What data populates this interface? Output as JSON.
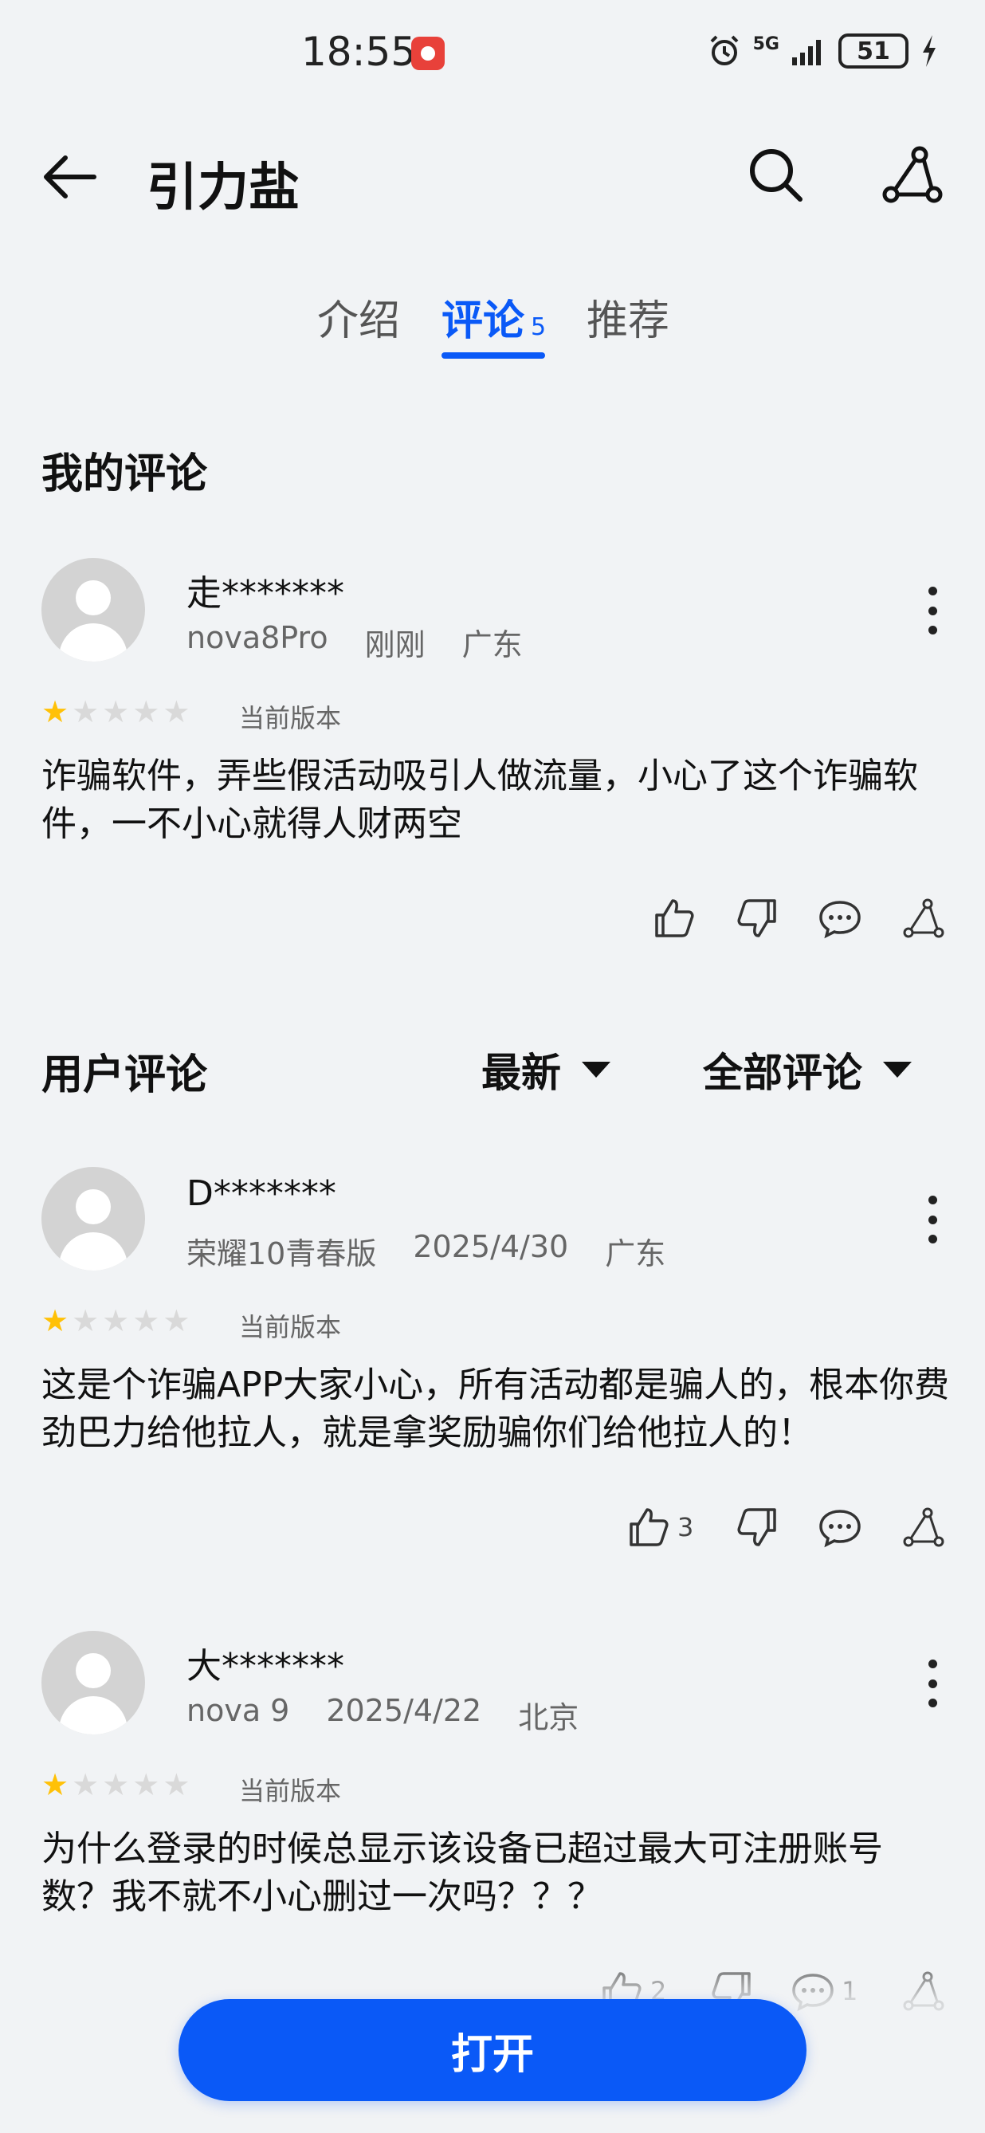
{
  "status_bar": {
    "time": "18:55",
    "network": "5G",
    "battery": "51",
    "icons": [
      "alarm-icon",
      "signal-icon",
      "charging-icon"
    ]
  },
  "header": {
    "title": "引力盐",
    "icons": [
      "back-arrow-icon",
      "search-icon",
      "share-icon"
    ]
  },
  "tabs": [
    {
      "label": "介绍"
    },
    {
      "label": "评论",
      "count": "5",
      "active": true
    },
    {
      "label": "推荐"
    }
  ],
  "my_reviews": {
    "section_title": "我的评论",
    "review": {
      "user": "走*******",
      "device": "nova8Pro",
      "time": "刚刚",
      "location": "广东",
      "rating": 1,
      "version_label": "当前版本",
      "text": "诈骗软件，弄些假活动吸引人做流量，小心了这个诈骗软件，一不小心就得人财两空"
    }
  },
  "user_reviews": {
    "section_title": "用户评论",
    "sort_latest": "最新",
    "filter_all": "全部评论",
    "items": [
      {
        "user": "D*******",
        "device": "荣耀10青春版",
        "time": "2025/4/30",
        "location": "广东",
        "rating": 1,
        "version_label": "当前版本",
        "text": "这是个诈骗APP大家小心，所有活动都是骗人的，根本你费劲巴力给他拉人，就是拿奖励骗你们给他拉人的！",
        "likes": "3",
        "comments": ""
      },
      {
        "user": "大*******",
        "device": "nova 9",
        "time": "2025/4/22",
        "location": "北京",
        "rating": 1,
        "version_label": "当前版本",
        "text": "为什么登录的时候总显示该设备已超过最大可注册账号数？我不就不小心删过一次吗？？？",
        "likes": "2",
        "comments": "1"
      }
    ]
  },
  "bottom": {
    "open_label": "打开"
  },
  "colors": {
    "accent": "#0a59f7",
    "background": "#f1f3f5",
    "star_on": "#ffc107",
    "star_off": "#d9d9d9"
  }
}
